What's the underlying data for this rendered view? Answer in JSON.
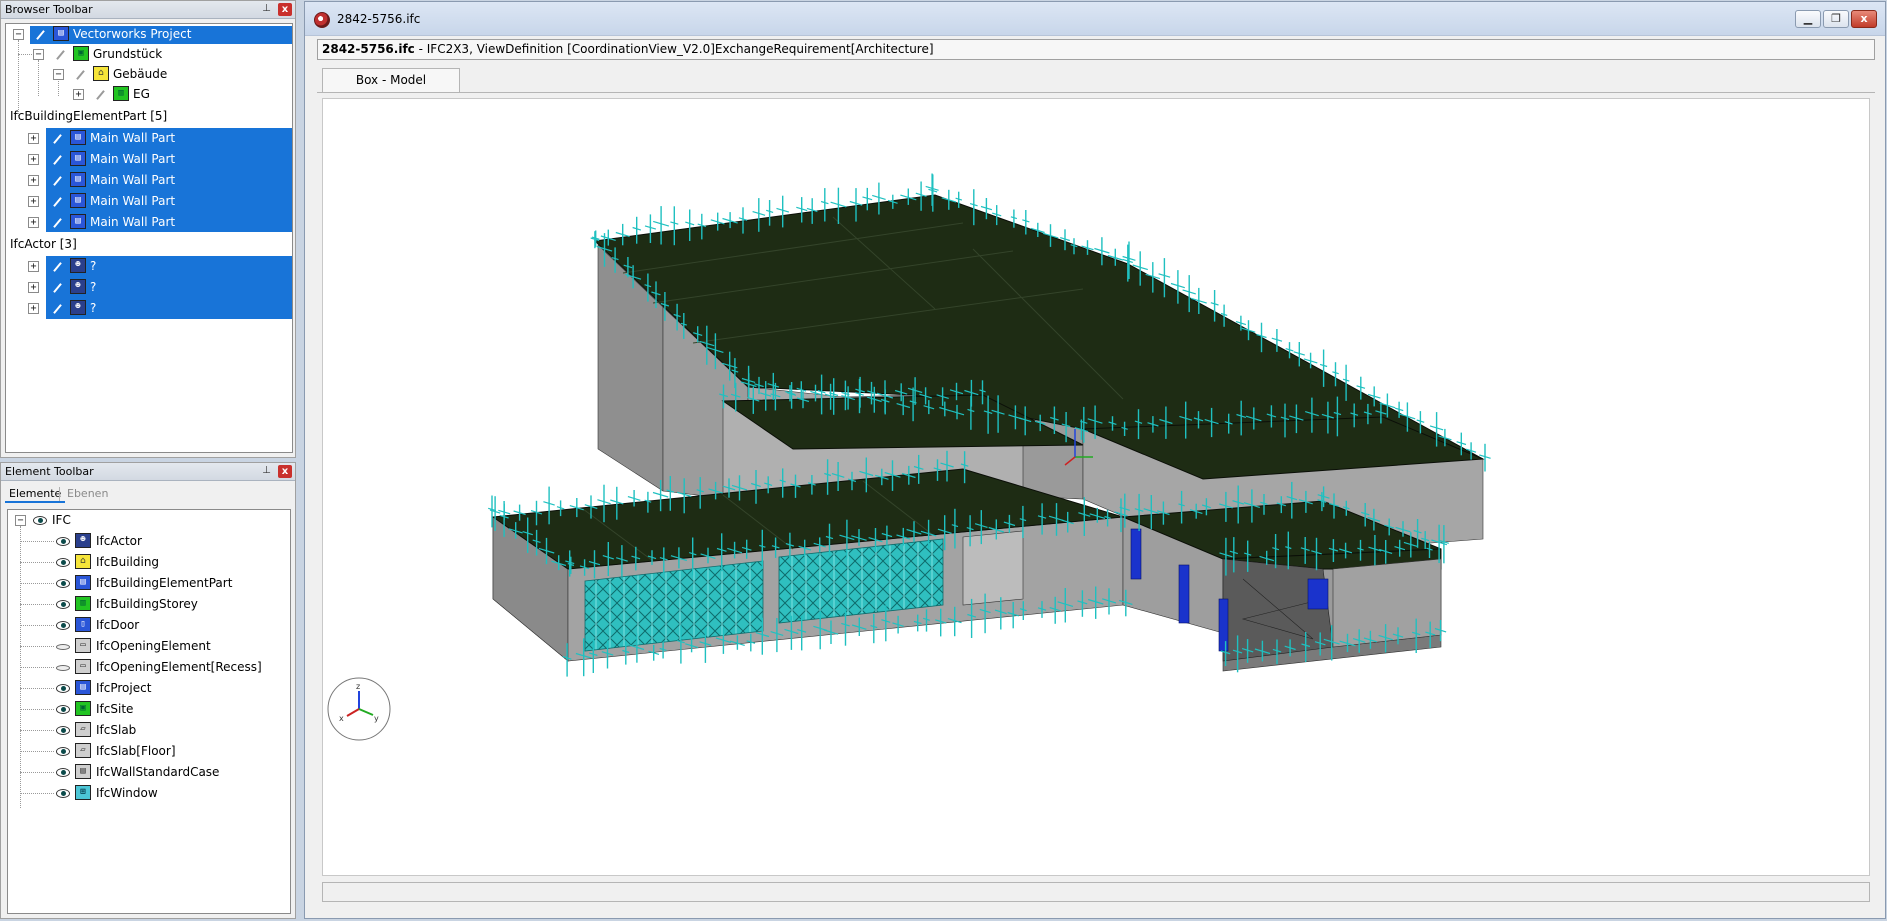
{
  "browser_toolbar": {
    "title": "Browser Toolbar",
    "pin_glyph": "⊥",
    "close_glyph": "x",
    "tree": [
      {
        "label": "Vectorworks Project",
        "icon": "project-icon",
        "selected": true
      },
      {
        "label": "Grundstück",
        "icon": "site-icon",
        "selected": false
      },
      {
        "label": "Gebäude",
        "icon": "building-icon",
        "selected": false
      },
      {
        "label": "EG",
        "icon": "storey-icon",
        "selected": false
      },
      {
        "label": "IfcBuildingElementPart [5]",
        "group": true
      },
      {
        "label": "Main Wall Part",
        "icon": "wall-part-icon",
        "selected": true
      },
      {
        "label": "Main Wall Part",
        "icon": "wall-part-icon",
        "selected": true
      },
      {
        "label": "Main Wall Part",
        "icon": "wall-part-icon",
        "selected": true
      },
      {
        "label": "Main Wall Part",
        "icon": "wall-part-icon",
        "selected": true
      },
      {
        "label": "Main Wall Part",
        "icon": "wall-part-icon",
        "selected": true
      },
      {
        "label": "IfcActor [3]",
        "group": true
      },
      {
        "label": "?",
        "icon": "actor-icon",
        "selected": true
      },
      {
        "label": "?",
        "icon": "actor-icon",
        "selected": true
      },
      {
        "label": "?",
        "icon": "actor-icon",
        "selected": true
      }
    ]
  },
  "element_toolbar": {
    "title": "Element Toolbar",
    "pin_glyph": "⊥",
    "close_glyph": "x",
    "tabs": [
      {
        "label": "Elemente",
        "active": true
      },
      {
        "label": "Ebenen",
        "active": false
      }
    ],
    "root": "IFC",
    "items": [
      {
        "label": "IfcActor",
        "icon": "actor-icon",
        "visible": true
      },
      {
        "label": "IfcBuilding",
        "icon": "building-icon",
        "visible": true
      },
      {
        "label": "IfcBuildingElementPart",
        "icon": "wall-part-icon",
        "visible": true
      },
      {
        "label": "IfcBuildingStorey",
        "icon": "storey-icon",
        "visible": true
      },
      {
        "label": "IfcDoor",
        "icon": "door-icon",
        "visible": true
      },
      {
        "label": "IfcOpeningElement",
        "icon": "opening-icon",
        "visible": false
      },
      {
        "label": "IfcOpeningElement[Recess]",
        "icon": "opening-icon",
        "visible": false
      },
      {
        "label": "IfcProject",
        "icon": "project-icon",
        "visible": true
      },
      {
        "label": "IfcSite",
        "icon": "site-icon",
        "visible": true
      },
      {
        "label": "IfcSlab",
        "icon": "slab-icon",
        "visible": true
      },
      {
        "label": "IfcSlab[Floor]",
        "icon": "slab-icon",
        "visible": true
      },
      {
        "label": "IfcWallStandardCase",
        "icon": "wall-icon",
        "visible": true
      },
      {
        "label": "IfcWindow",
        "icon": "window-icon",
        "visible": true
      }
    ]
  },
  "window": {
    "title": "2842-5756.ifc",
    "minimize_glyph": "▁",
    "restore_glyph": "❐",
    "close_glyph": "x",
    "info_file": "2842-5756.ifc",
    "info_rest": " - IFC2X3, ViewDefinition [CoordinationView_V2.0]ExchangeRequirement[Architecture]",
    "view_tab": "Box - Model",
    "axes": {
      "z": "z",
      "x": "x",
      "y": "y"
    }
  },
  "colors": {
    "selection": "#1874d8",
    "slab_top": "#1e2c14",
    "wall": "#9a9a9a",
    "opening_marker": "#1fc0c0",
    "door": "#1a33cc"
  }
}
